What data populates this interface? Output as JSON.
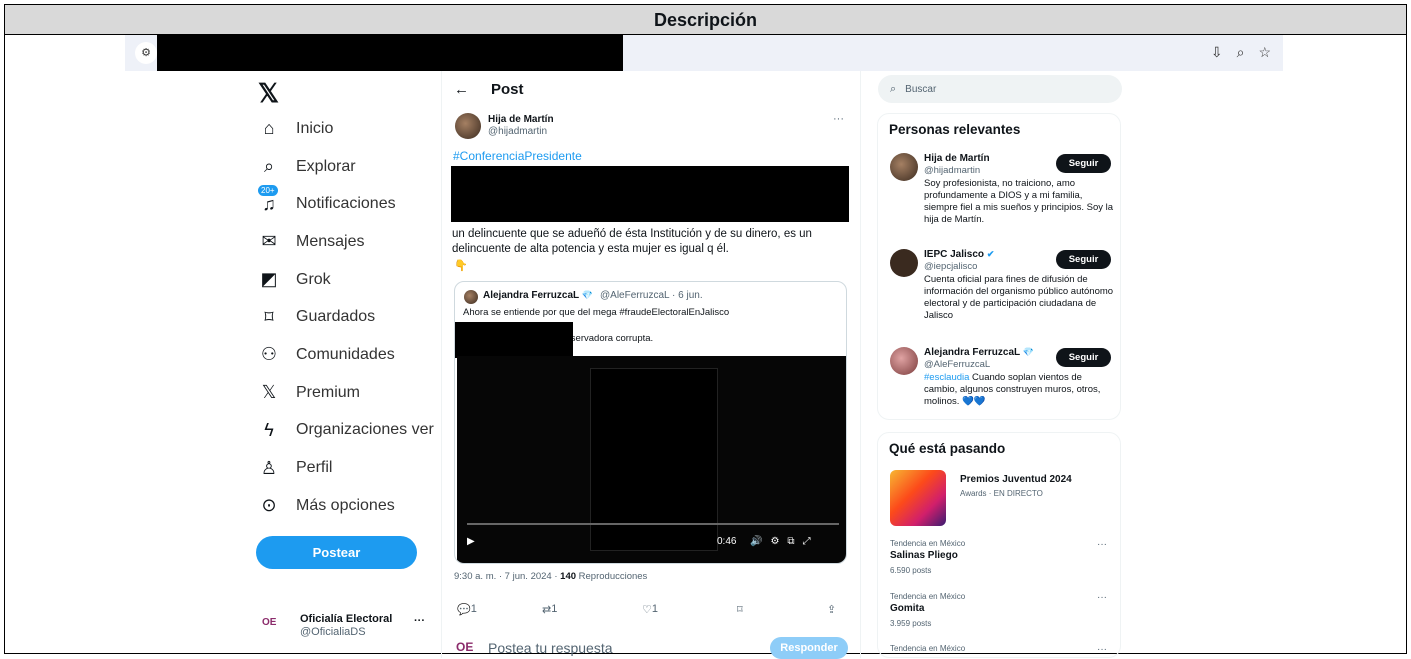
{
  "doc": {
    "header": "Descripción"
  },
  "browser": {
    "icons": [
      "tune-icon",
      "install-icon",
      "zoom-icon",
      "star-icon"
    ]
  },
  "nav": {
    "items": [
      {
        "label": "Inicio",
        "icon": "home-icon"
      },
      {
        "label": "Explorar",
        "icon": "search-icon"
      },
      {
        "label": "Notificaciones",
        "icon": "bell-icon",
        "badge": "20+"
      },
      {
        "label": "Mensajes",
        "icon": "mail-icon"
      },
      {
        "label": "Grok",
        "icon": "grok-icon"
      },
      {
        "label": "Guardados",
        "icon": "bookmark-icon"
      },
      {
        "label": "Comunidades",
        "icon": "communities-icon"
      },
      {
        "label": "Premium",
        "icon": "x-icon"
      },
      {
        "label": "Organizaciones ver",
        "icon": "lightning-icon"
      },
      {
        "label": "Perfil",
        "icon": "person-icon"
      },
      {
        "label": "Más opciones",
        "icon": "more-circle-icon"
      }
    ],
    "post_button": "Postear",
    "account": {
      "logo": "OE",
      "name": "Oficialía Electoral",
      "handle": "@OficialiaDS",
      "more": "···"
    }
  },
  "post": {
    "header": "Post",
    "author_name": "Hija de Martín",
    "author_handle": "@hijadmartin",
    "more": "···",
    "hashtag": "#ConferenciaPresidente",
    "text": "un delincuente que se adueñó de ésta Institución y de su dinero, es un delincuente de alta potencia y esta mujer es igual q él.",
    "quote": {
      "name": "Alejandra FerruzcaL",
      "handle_date": "@AleFerruzcaL · 6 jun.",
      "text": "Ahora se entiende por que del mega #fraudeElectoralEnJalisco",
      "text2": "una conservadora corrupta.",
      "video_time": "0:46"
    },
    "meta_time": "9:30 a. m. · 7 jun. 2024 · ",
    "meta_views": "140",
    "meta_views_label": " Reproducciones",
    "actions": {
      "replies": "1",
      "reposts": "1",
      "likes": "1"
    },
    "reply_logo": "OE",
    "reply_placeholder": "Postea tu respuesta",
    "reply_button": "Responder"
  },
  "right": {
    "search_placeholder": "Buscar",
    "relevant_title": "Personas relevantes",
    "people": [
      {
        "name": "Hija de Martín",
        "handle": "@hijadmartin",
        "bio": "Soy profesionista, no traiciono, amo profundamente a DIOS y a mi familia, siempre fiel a mis sueños y principios. Soy la hija de Martín.",
        "follow": "Seguir"
      },
      {
        "name": "IEPC Jalisco",
        "handle": "@iepcjalisco",
        "bio": "Cuenta oficial para fines de difusión de información del organismo público autónomo electoral y de participación ciudadana de Jalisco",
        "follow": "Seguir"
      },
      {
        "name": "Alejandra FerruzcaL",
        "handle": "@AleFerruzcaL",
        "bio_tag": "#esclaudia",
        "bio": " Cuando soplan vientos de cambio, algunos construyen muros, otros, molinos. 💙💙",
        "follow": "Seguir"
      }
    ],
    "trending_title": "Qué está pasando",
    "featured": {
      "title": "Premios Juventud 2024",
      "sub": "Awards · EN DIRECTO"
    },
    "trends": [
      {
        "category": "Tendencia en México",
        "name": "Salinas Pliego",
        "count": "6.590 posts"
      },
      {
        "category": "Tendencia en México",
        "name": "Gomita",
        "count": "3.959 posts"
      },
      {
        "category": "Tendencia en México",
        "name": "",
        "count": ""
      }
    ]
  }
}
